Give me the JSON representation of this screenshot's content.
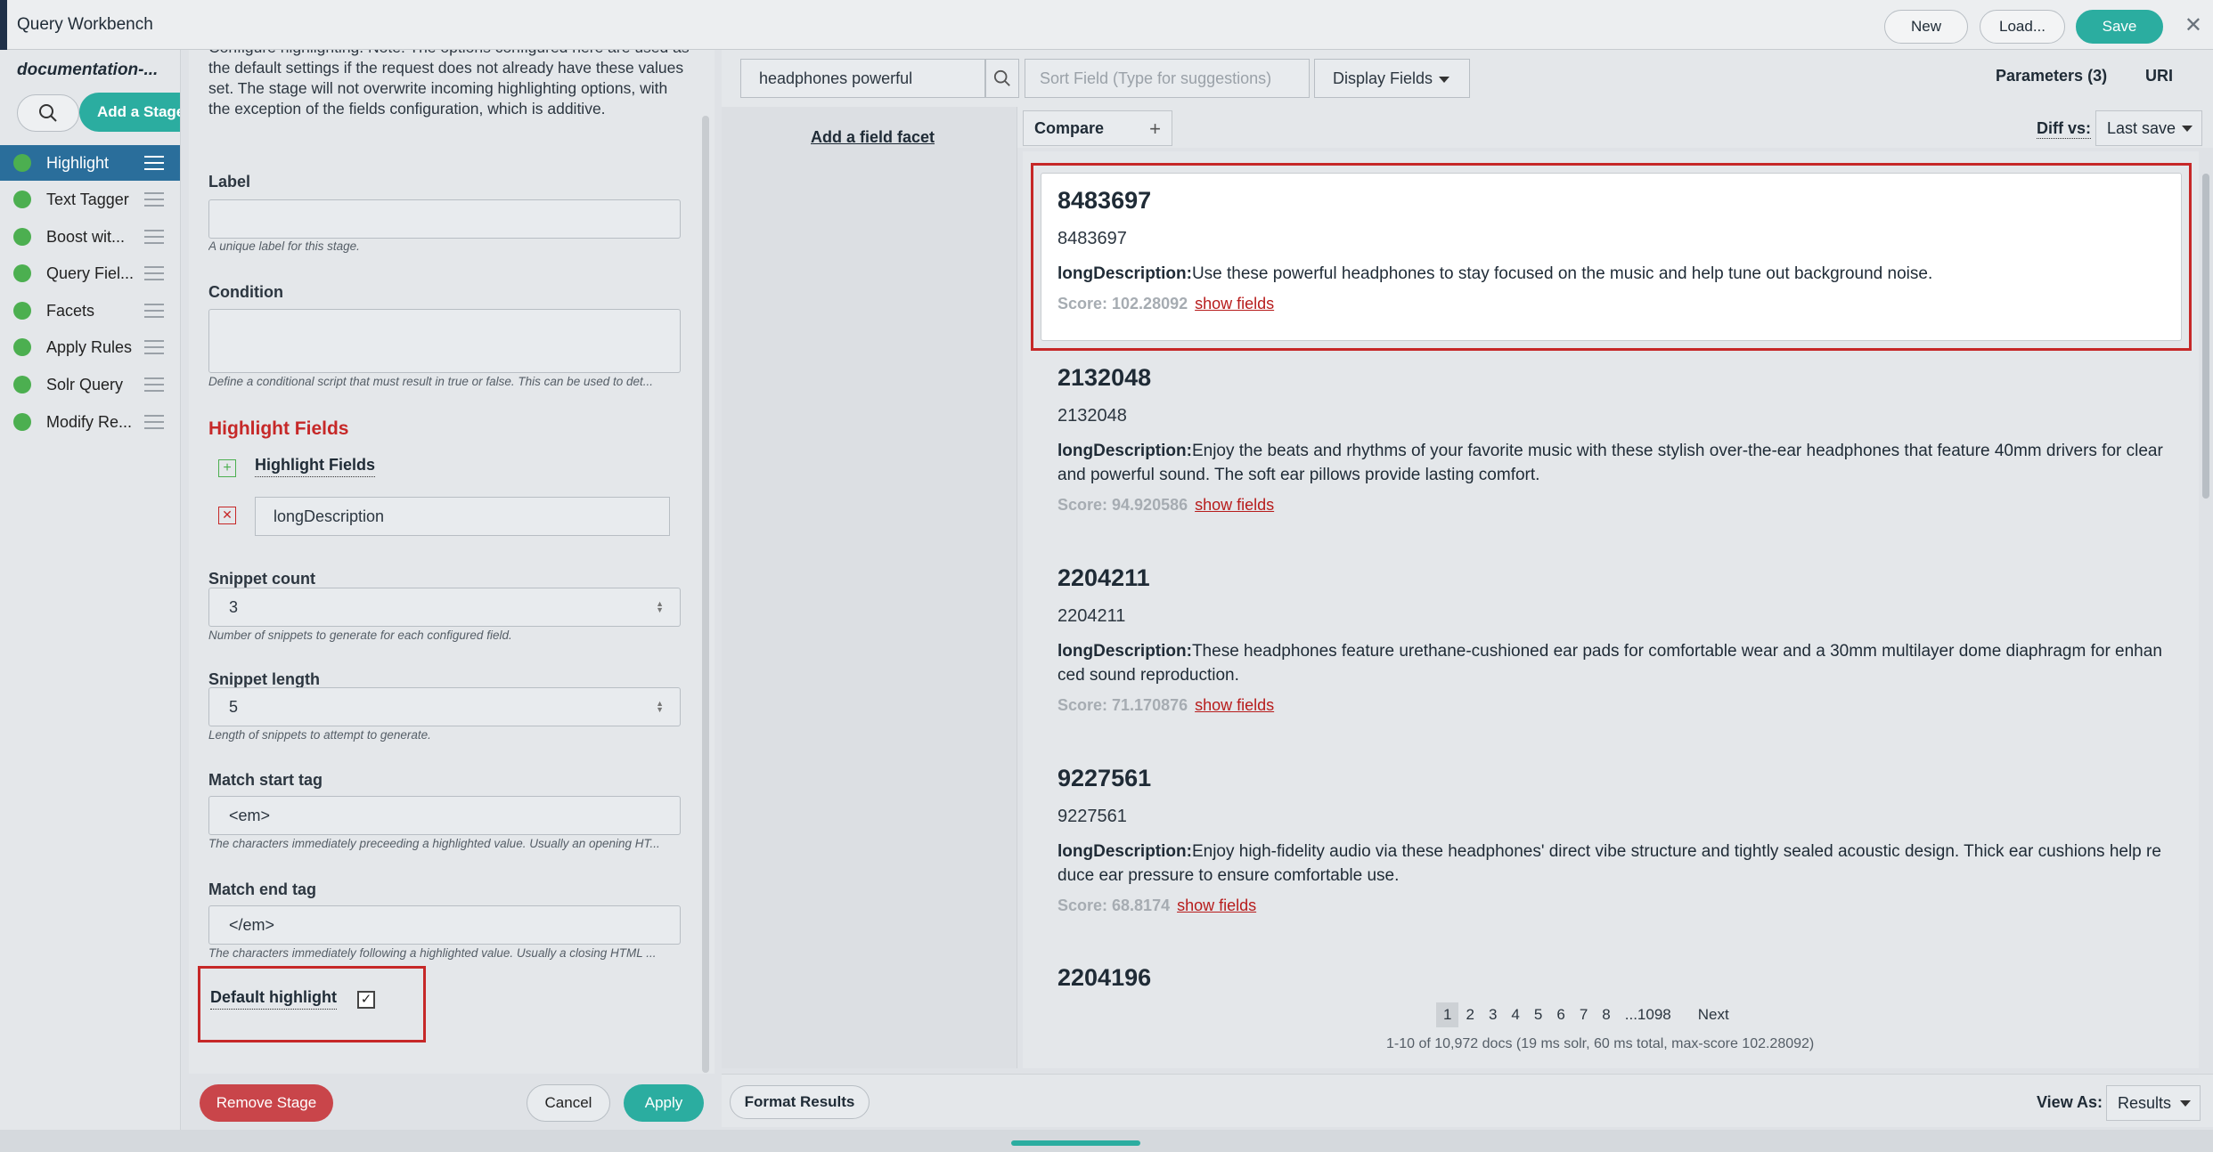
{
  "app": {
    "title": "Query Workbench",
    "new_label": "New",
    "load_label": "Load...",
    "save_label": "Save"
  },
  "sidebar": {
    "project": "documentation-...",
    "add_stage_label": "Add a Stage",
    "stages": [
      {
        "label": "Highlight",
        "active": true
      },
      {
        "label": "Text Tagger"
      },
      {
        "label": "Boost wit..."
      },
      {
        "label": "Query Fiel..."
      },
      {
        "label": "Facets"
      },
      {
        "label": "Apply Rules"
      },
      {
        "label": "Solr Query"
      },
      {
        "label": "Modify Re..."
      }
    ]
  },
  "config": {
    "description": "Configure highlighting. Note: The options configured here are used as the default settings if the request does not already have these values set. The stage will not overwrite incoming highlighting options, with the exception of the fields configuration, which is additive.",
    "label_label": "Label",
    "label_value": "",
    "label_help": "A unique label for this stage.",
    "condition_label": "Condition",
    "condition_value": "",
    "condition_help": "Define a conditional script that must result in true or false. This can be used to det...",
    "highlight_fields_title": "Highlight Fields",
    "highlight_fields_label": "Highlight Fields",
    "highlight_field_value": "longDescription",
    "snippet_count_label": "Snippet count",
    "snippet_count_value": "3",
    "snippet_count_help": "Number of snippets to generate for each configured field.",
    "snippet_length_label": "Snippet length",
    "snippet_length_value": "5",
    "snippet_length_help": "Length of snippets to attempt to generate.",
    "match_start_label": "Match start tag",
    "match_start_value": "<em>",
    "match_start_help": "The characters immediately preceeding a highlighted value. Usually an opening HT...",
    "match_end_label": "Match end tag",
    "match_end_value": "</em>",
    "match_end_help": "The characters immediately following a highlighted value. Usually a closing HTML ...",
    "default_highlight_label": "Default highlight",
    "default_highlight_checked": true,
    "remove_label": "Remove Stage",
    "cancel_label": "Cancel",
    "apply_label": "Apply"
  },
  "query": {
    "text": "headphones powerful",
    "sort_placeholder": "Sort Field (Type for suggestions)",
    "display_fields_label": "Display Fields",
    "parameters_label": "Parameters (3)",
    "uri_label": "URI"
  },
  "facets": {
    "add_label": "Add a field facet"
  },
  "compare": {
    "label": "Compare",
    "diff_label": "Diff vs:",
    "diff_value": "Last save"
  },
  "results": [
    {
      "id": "8483697",
      "id2": "8483697",
      "field": "longDescription:",
      "desc": "Use these powerful headphones to stay focused on the music and help tune out background noise.",
      "score": "Score: 102.28092",
      "show": "show fields"
    },
    {
      "id": "2132048",
      "id2": "2132048",
      "field": "longDescription:",
      "desc": "Enjoy the beats and rhythms of your favorite music with these stylish over-the-ear headphones that feature 40mm drivers for clear and powerful sound. The soft ear pillows provide lasting comfort.",
      "score": "Score: 94.920586",
      "show": "show fields"
    },
    {
      "id": "2204211",
      "id2": "2204211",
      "field": "longDescription:",
      "desc": "These headphones feature urethane-cushioned ear pads for comfortable wear and a 30mm multilayer dome diaphragm for enhanced sound reproduction.",
      "score": "Score: 71.170876",
      "show": "show fields"
    },
    {
      "id": "9227561",
      "id2": "9227561",
      "field": "longDescription:",
      "desc": "Enjoy high-fidelity audio via these headphones' direct vibe structure and tightly sealed acoustic design. Thick ear cushions help reduce ear pressure to ensure comfortable use.",
      "score": "Score: 68.8174",
      "show": "show fields"
    },
    {
      "id": "2204196"
    }
  ],
  "pager": {
    "pages": [
      "1",
      "2",
      "3",
      "4",
      "5",
      "6",
      "7",
      "8",
      "...1098",
      "Next"
    ],
    "info": "1-10 of 10,972 docs (19 ms solr, 60 ms total, max-score 102.28092)"
  },
  "footer": {
    "format_label": "Format Results",
    "view_as_label": "View As:",
    "view_as_value": "Results"
  }
}
